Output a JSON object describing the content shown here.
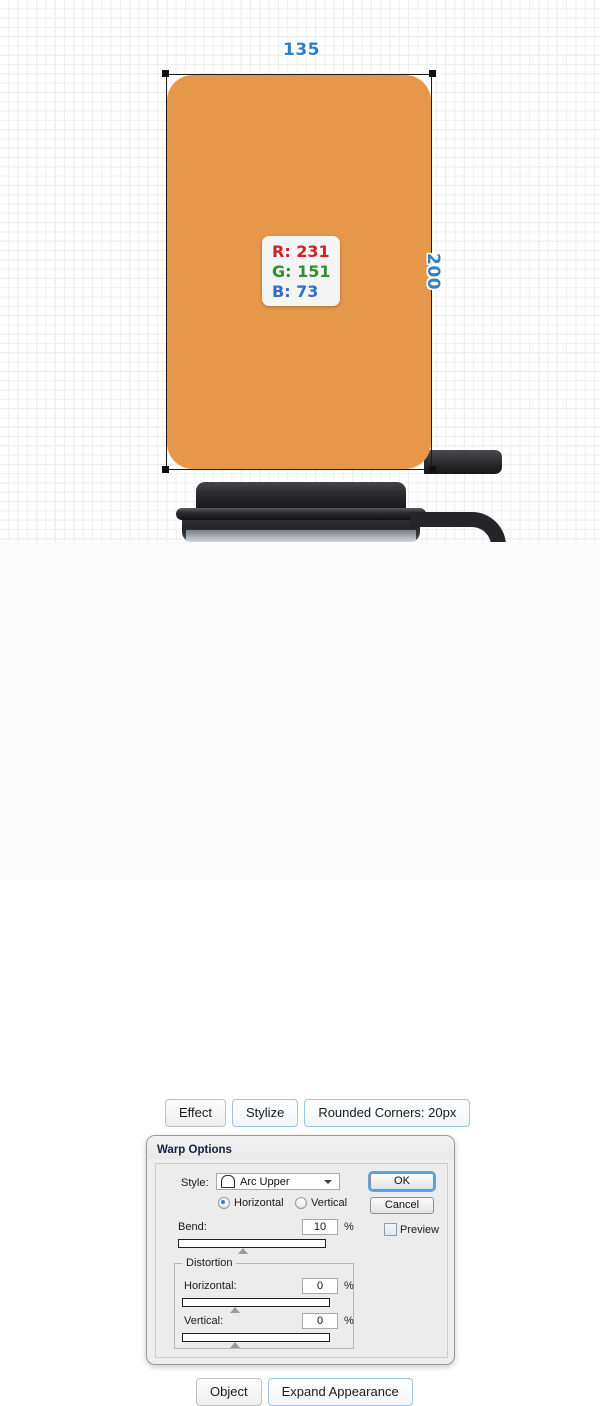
{
  "canvas": {
    "dimensions": {
      "width_label": "135",
      "height_label": "200"
    },
    "color_readout": {
      "red": "R: 231",
      "green": "G: 151",
      "blue": "B: 73",
      "hex": "#e79749"
    },
    "shape_name": "rounded-rectangle",
    "artwork_name": "coffee-maker-illustration"
  },
  "breadcrumb": {
    "items": [
      {
        "label": "Effect",
        "highlight": false
      },
      {
        "label": "Stylize",
        "highlight": true
      },
      {
        "label": "Rounded Corners: 20px",
        "highlight": true
      }
    ]
  },
  "dialog": {
    "title": "Warp Options",
    "style": {
      "label": "Style:",
      "value": "Arc Upper",
      "icon": "arc-upper-icon",
      "chevron": "chevron-down-icon"
    },
    "orientation": {
      "horizontal": "Horizontal",
      "vertical": "Vertical",
      "selected": "Horizontal"
    },
    "bend": {
      "label": "Bend:",
      "value": "10",
      "unit": "%"
    },
    "distortion": {
      "legend": "Distortion",
      "horizontal": {
        "label": "Horizontal:",
        "value": "0",
        "unit": "%"
      },
      "vertical": {
        "label": "Vertical:",
        "value": "0",
        "unit": "%"
      }
    },
    "buttons": {
      "ok": "OK",
      "cancel": "Cancel"
    },
    "preview": {
      "label": "Preview",
      "checked": false
    }
  },
  "bottom_bar": {
    "items": [
      {
        "label": "Object",
        "highlight": false
      },
      {
        "label": "Expand Appearance",
        "highlight": true
      }
    ]
  }
}
